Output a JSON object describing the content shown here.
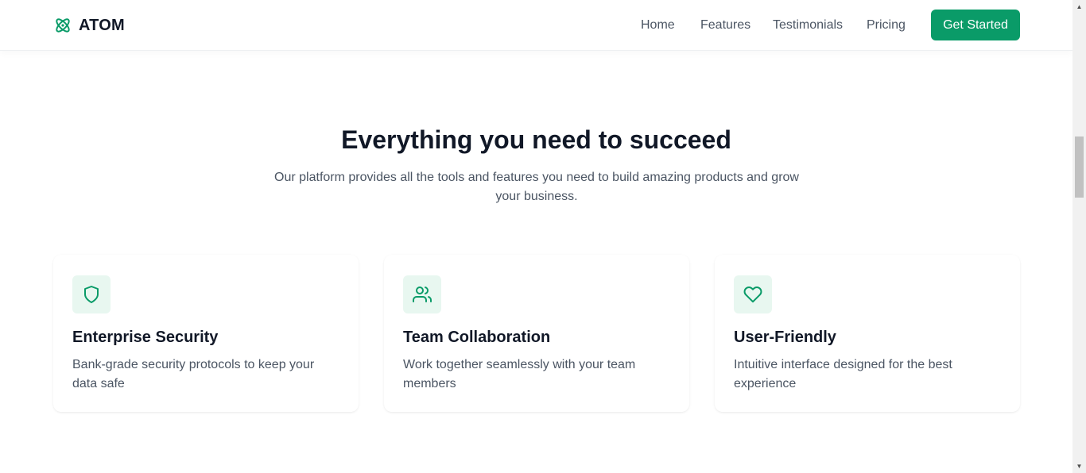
{
  "header": {
    "brand": "ATOM",
    "nav": [
      {
        "label": "Home"
      },
      {
        "label": "Features"
      },
      {
        "label": "Testimonials"
      },
      {
        "label": "Pricing"
      }
    ],
    "cta_label": "Get Started"
  },
  "features": {
    "title": "Everything you need to succeed",
    "subtitle": "Our platform provides all the tools and features you need to build amazing products and grow your business.",
    "cards": [
      {
        "icon": "shield-icon",
        "title": "Enterprise Security",
        "text": "Bank-grade security protocols to keep your data safe"
      },
      {
        "icon": "users-icon",
        "title": "Team Collaboration",
        "text": "Work together seamlessly with your team members"
      },
      {
        "icon": "heart-icon",
        "title": "User-Friendly",
        "text": "Intuitive interface designed for the best experience"
      }
    ]
  },
  "colors": {
    "accent": "#0a9b68",
    "icon_bg": "#e8f7f0",
    "heading": "#111827",
    "body_text": "#4b5563"
  }
}
